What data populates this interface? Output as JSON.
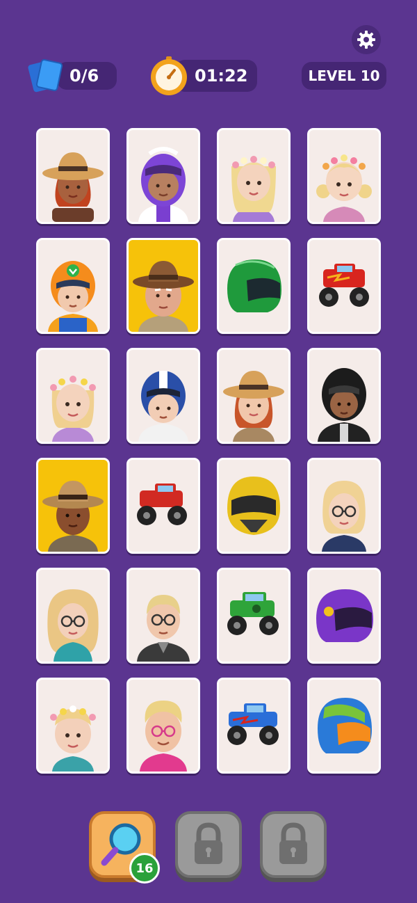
{
  "header": {
    "cards_progress": "0/6",
    "timer": "01:22",
    "level": "LEVEL 10",
    "icons": [
      "settings-gear-icon",
      "cards-icon",
      "stopwatch-icon"
    ]
  },
  "board": {
    "rows": 6,
    "columns": 4,
    "cards": [
      "woman-sun-hat",
      "racer-purple-helmet",
      "woman-flower-crown-blonde",
      "girl-flower-crown-pigtails",
      "racer-orange-helmet",
      "old-man-fedora-yellow",
      "green-helmet",
      "red-monster-truck",
      "girl-flower-crown",
      "racer-blue-white-helmet",
      "woman-sun-hat-redhead",
      "racer-black-helmet",
      "man-fedora-yellow",
      "red-monster-truck",
      "yellow-helmet",
      "woman-glasses-blonde",
      "woman-glasses-scarf",
      "man-glasses-suit",
      "green-monster-truck",
      "purple-helmet",
      "boy-flower-crown",
      "man-pink-glasses",
      "blue-monster-truck",
      "green-blue-helmet"
    ]
  },
  "powerups": {
    "hint_count": "16",
    "items": [
      "magnifier-hint",
      "locked",
      "locked"
    ]
  },
  "colors": {
    "background": "#5b3590",
    "pill": "#452674",
    "card": "#f5ece9",
    "card_yellow": "#f6c20a"
  }
}
